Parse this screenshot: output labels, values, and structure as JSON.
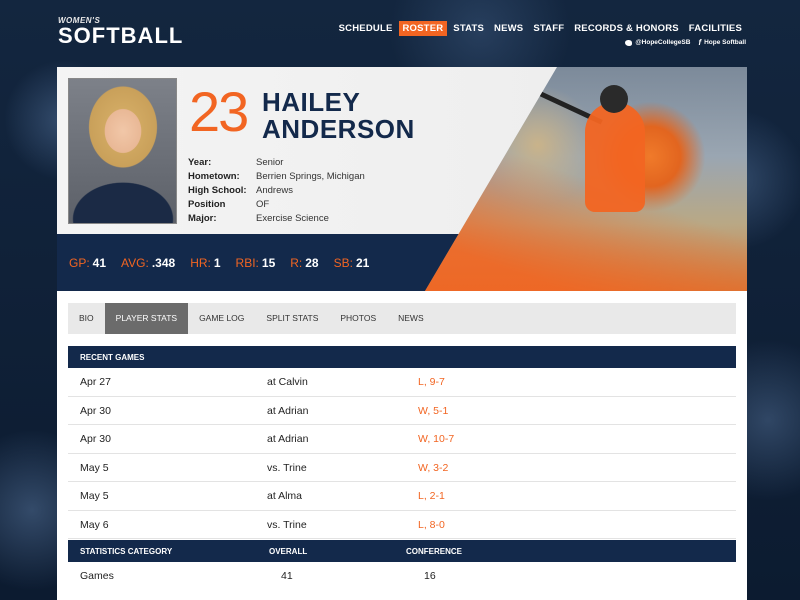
{
  "brand": {
    "subtitle": "WOMEN'S",
    "title": "SOFTBALL"
  },
  "nav": [
    "SCHEDULE",
    "ROSTER",
    "STATS",
    "NEWS",
    "STAFF",
    "RECORDS & HONORS",
    "FACILITIES"
  ],
  "nav_active": "ROSTER",
  "social": {
    "twitter": "@HopeCollegeSB",
    "facebook": "Hope Softball"
  },
  "player": {
    "number": "23",
    "first_name": "HAILEY",
    "last_name": "ANDERSON",
    "info": [
      {
        "label": "Year:",
        "value": "Senior"
      },
      {
        "label": "Hometown:",
        "value": "Berrien Springs, Michigan"
      },
      {
        "label": "High School:",
        "value": "Andrews"
      },
      {
        "label": "Position",
        "value": "OF"
      },
      {
        "label": "Major:",
        "value": "Exercise Science"
      }
    ],
    "stats": [
      {
        "label": "GP:",
        "value": "41"
      },
      {
        "label": "AVG:",
        "value": ".348"
      },
      {
        "label": "HR:",
        "value": "1"
      },
      {
        "label": "RBI:",
        "value": "15"
      },
      {
        "label": "R:",
        "value": "28"
      },
      {
        "label": "SB:",
        "value": "21"
      }
    ]
  },
  "tabs": [
    "BIO",
    "PLAYER STATS",
    "GAME LOG",
    "SPLIT STATS",
    "PHOTOS",
    "NEWS"
  ],
  "active_tab": "PLAYER STATS",
  "recent_games": {
    "header": "RECENT GAMES",
    "rows": [
      {
        "date": "Apr 27",
        "opponent": "at Calvin",
        "result": "L, 9-7"
      },
      {
        "date": "Apr 30",
        "opponent": "at Adrian",
        "result": "W, 5-1"
      },
      {
        "date": "Apr 30",
        "opponent": "at Adrian",
        "result": "W, 10-7"
      },
      {
        "date": "May 5",
        "opponent": "vs. Trine",
        "result": "W, 3-2"
      },
      {
        "date": "May 5",
        "opponent": "at Alma",
        "result": "L, 2-1"
      },
      {
        "date": "May 6",
        "opponent": "vs. Trine",
        "result": "L, 8-0"
      }
    ]
  },
  "stats_table": {
    "headers": [
      "STATISTICS CATEGORY",
      "OVERALL",
      "CONFERENCE"
    ],
    "rows": [
      {
        "category": "Games",
        "overall": "41",
        "conference": "16"
      }
    ]
  },
  "colors": {
    "accent": "#f26522",
    "navy": "#13294b",
    "tab_active": "#6b6b6b"
  }
}
